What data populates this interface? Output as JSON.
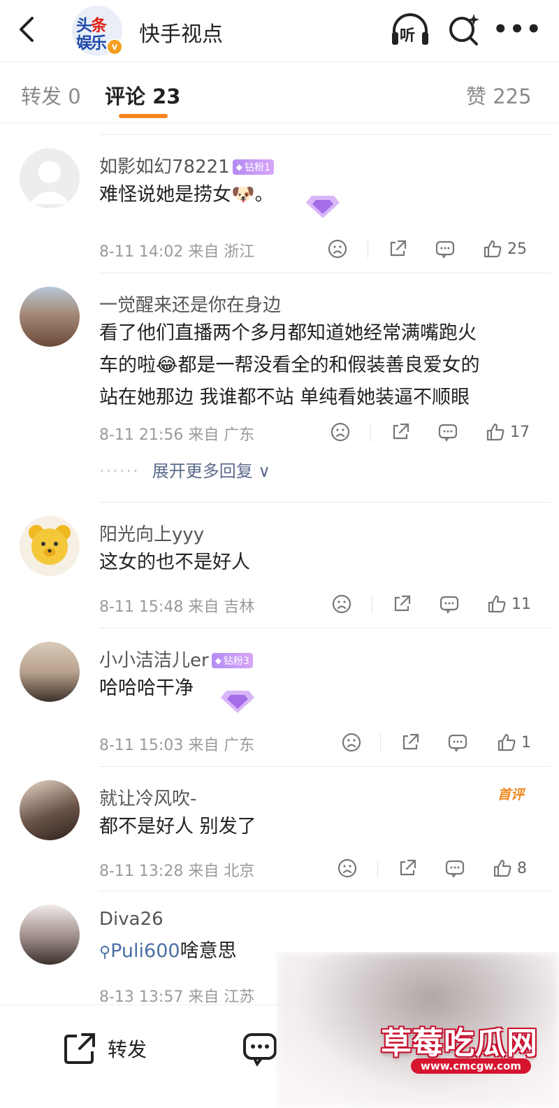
{
  "header": {
    "title": "快手视点",
    "avatar_line1a": "头",
    "avatar_line1b": "条",
    "avatar_line2": "娱乐",
    "verified_mark": "v",
    "listen_label": "听"
  },
  "tabs": {
    "repost": "转发 0",
    "comments": "评论 23",
    "likes": "赞 225"
  },
  "comments": [
    {
      "username": "如影如幻78221",
      "fan_badge": "钻粉1",
      "text": "难怪说她是捞女🐶。",
      "meta": "8-11 14:02 来自 浙江",
      "likes": "25",
      "avatar_color": "#ededed"
    },
    {
      "username": "一觉醒来还是你在身边",
      "text_lines": [
        "看了他们直播两个多月都知道她经常满嘴跑火",
        "车的啦😂都是一帮没看全的和假装善良爱女的",
        "站在她那边 我谁都不站 单纯看她装逼不顺眼"
      ],
      "meta": "8-11 21:56 来自 广东",
      "likes": "17",
      "expand_label": "展开更多回复",
      "expand_dots": "······",
      "avatar_color": "#a98a7a"
    },
    {
      "username": "阳光向上yyy",
      "text": "这女的也不是好人",
      "meta": "8-11 15:48 来自 吉林",
      "likes": "11",
      "avatar_color": "#f3c83a"
    },
    {
      "username": "小小洁洁儿er",
      "fan_badge": "钻粉3",
      "text": "哈哈哈干净",
      "meta": "8-11 15:03 来自 广东",
      "likes": "1",
      "avatar_color": "#c9b8a8"
    },
    {
      "username": "就让冷风吹-",
      "first_badge": "首评",
      "text": "都不是好人 别发了",
      "meta": "8-11 13:28 来自 北京",
      "likes": "8",
      "avatar_color": "#6b5a4e"
    },
    {
      "username": "Diva26",
      "topic": "Puli600",
      "text_after_topic": "啥意思",
      "meta": "8-13 13:57 来自 江苏",
      "avatar_color": "#8d7d76"
    }
  ],
  "bottom_bar": {
    "repost_label": "转发"
  },
  "watermark": {
    "title": "草莓吃瓜网",
    "url": "www.cmcgw.com"
  },
  "colors": {
    "accent": "#f5861f",
    "link": "#4a6fa5",
    "muted": "#9a9a9a",
    "fan_badge": "#b48cf5",
    "watermark_red": "#d6142e"
  }
}
